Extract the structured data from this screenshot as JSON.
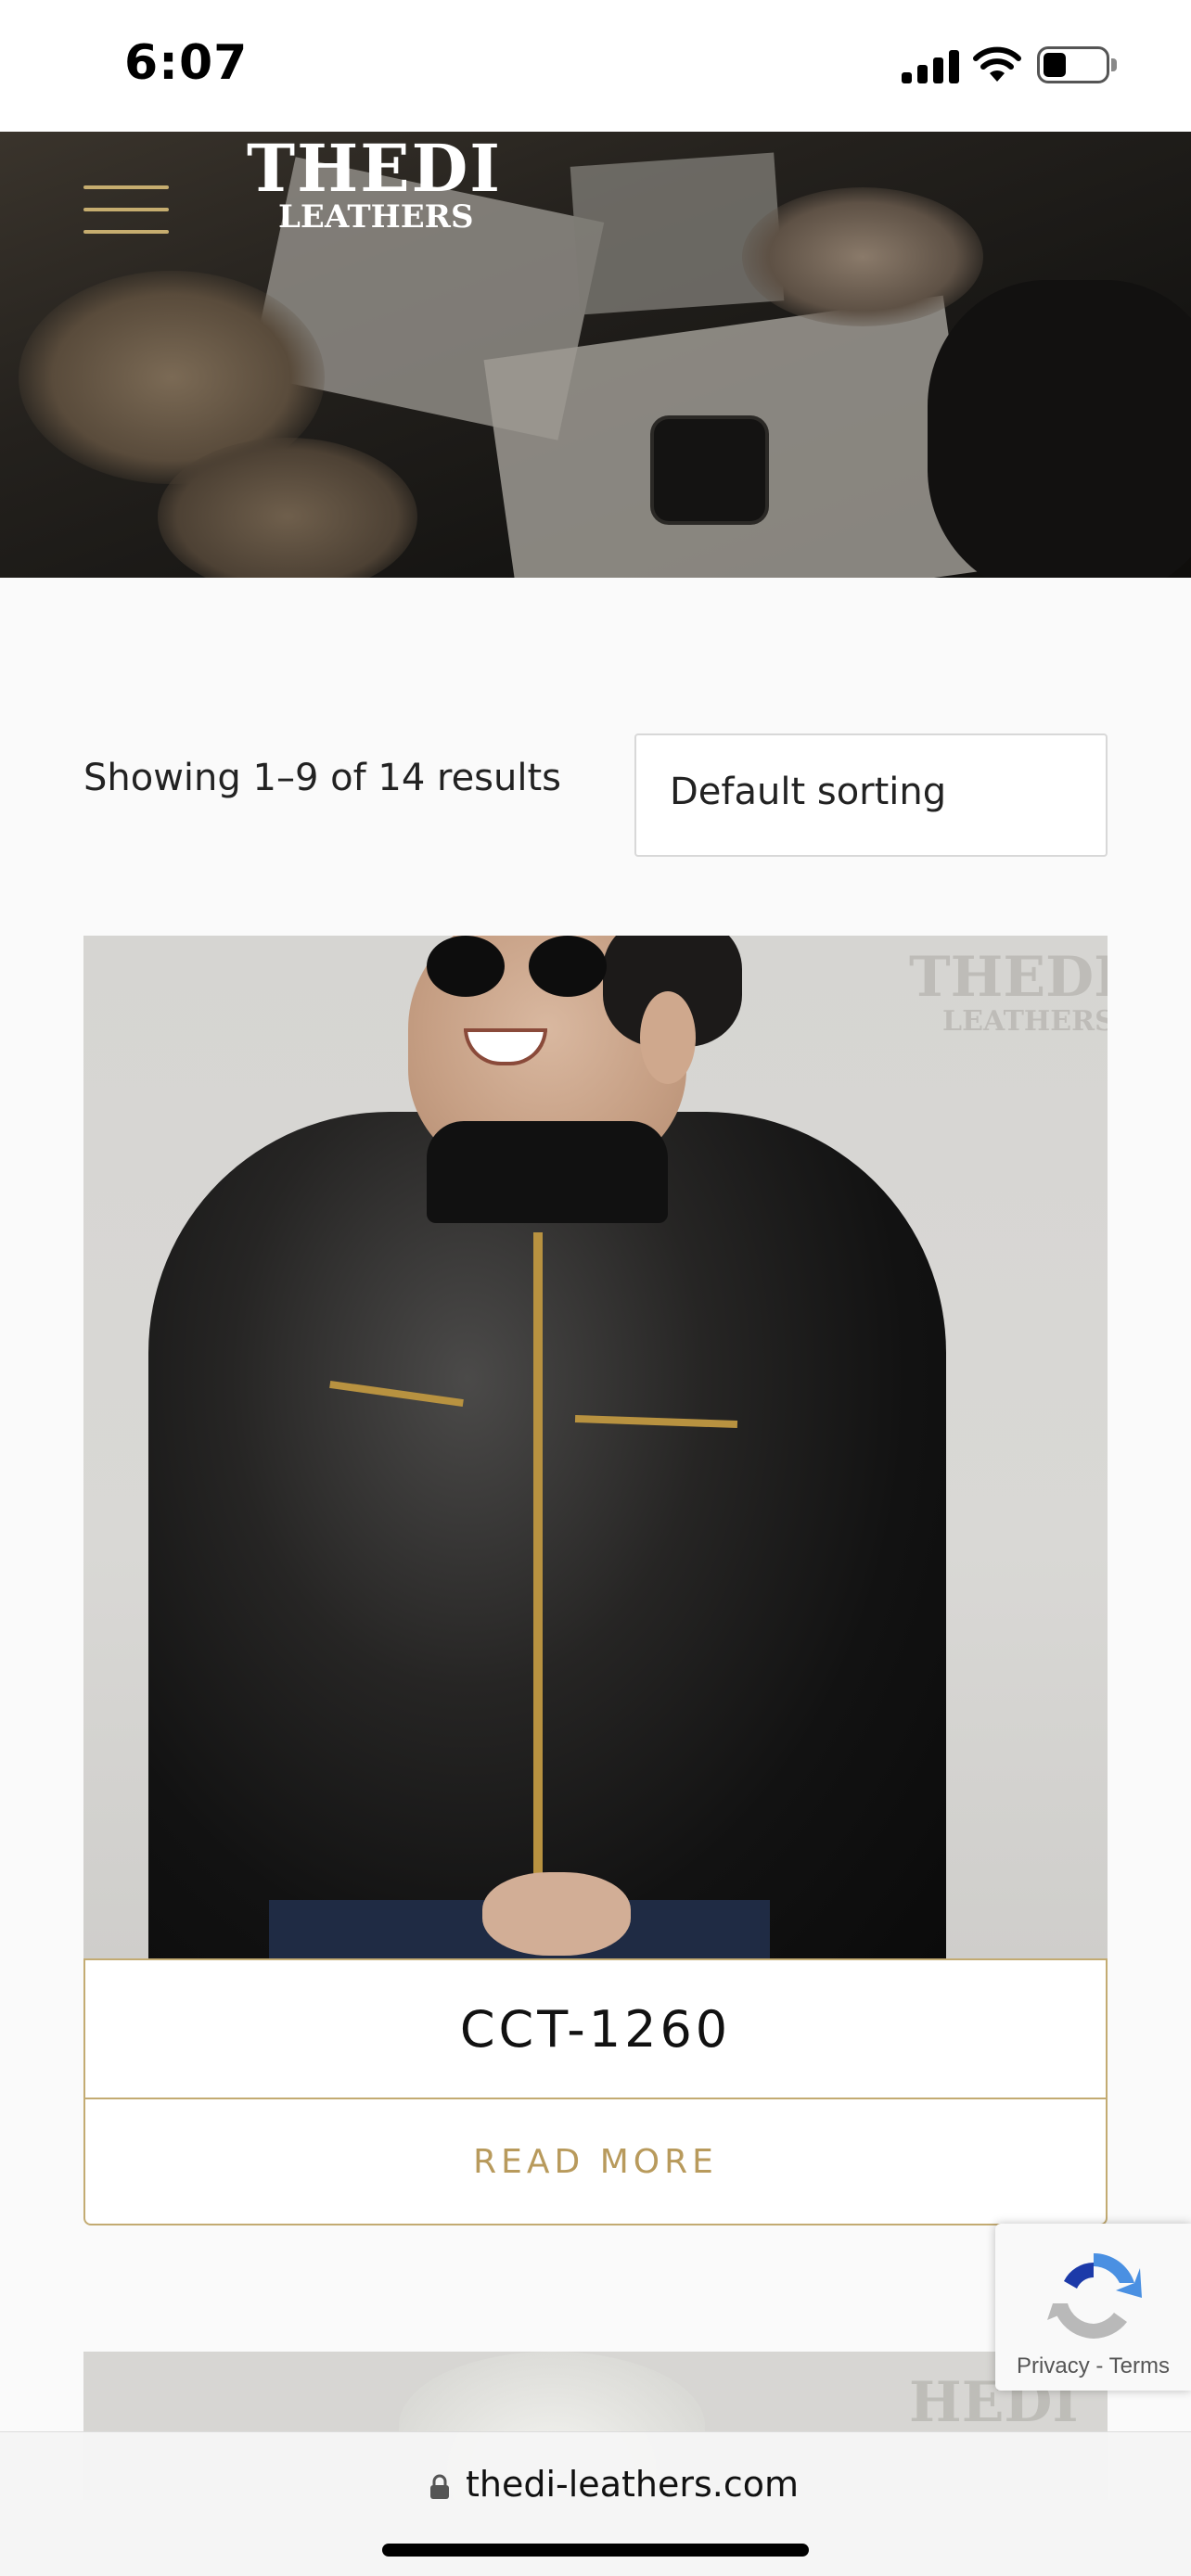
{
  "status_bar": {
    "time": "6:07"
  },
  "header": {
    "logo_line1": "HEDI",
    "logo_line2": "LEATHERS",
    "logo_initial": "T"
  },
  "shop": {
    "results_text": "Showing 1–9 of 14 results",
    "sort_selected": "Default sorting"
  },
  "product": {
    "title": "CCT-1260",
    "read_more": "READ MORE"
  },
  "recaptcha": {
    "privacy": "Privacy",
    "separator": "-",
    "terms": "Terms"
  },
  "browser": {
    "url": "thedi-leathers.com"
  },
  "colors": {
    "accent_gold": "#c3ab72",
    "read_more_text": "#b89a5c"
  }
}
